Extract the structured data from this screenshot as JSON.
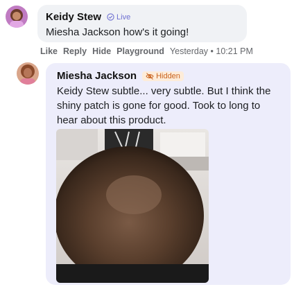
{
  "comment1": {
    "author": "Keidy Stew",
    "badge": "Live",
    "text": "Miesha Jackson how's it going!",
    "colors": {
      "bubble": "#f0f2f5",
      "badge": "#6d6fd1"
    }
  },
  "comment1_actions": {
    "like": "Like",
    "reply": "Reply",
    "hide": "Hide",
    "playground": "Playground",
    "timestamp": "Yesterday • 10:21 PM"
  },
  "comment2": {
    "author": "Miesha Jackson",
    "badge": "Hidden",
    "text": "Keidy Stew subtle... very subtle. But I think the shiny patch is gone for good. Took to long to hear about this product.",
    "colors": {
      "bubble": "#ededfb",
      "badge_bg": "#fdecd9",
      "badge_fg": "#c9631f"
    }
  },
  "icons": {
    "live_badge": "check-circle-icon",
    "hidden_badge": "eye-off-icon"
  }
}
